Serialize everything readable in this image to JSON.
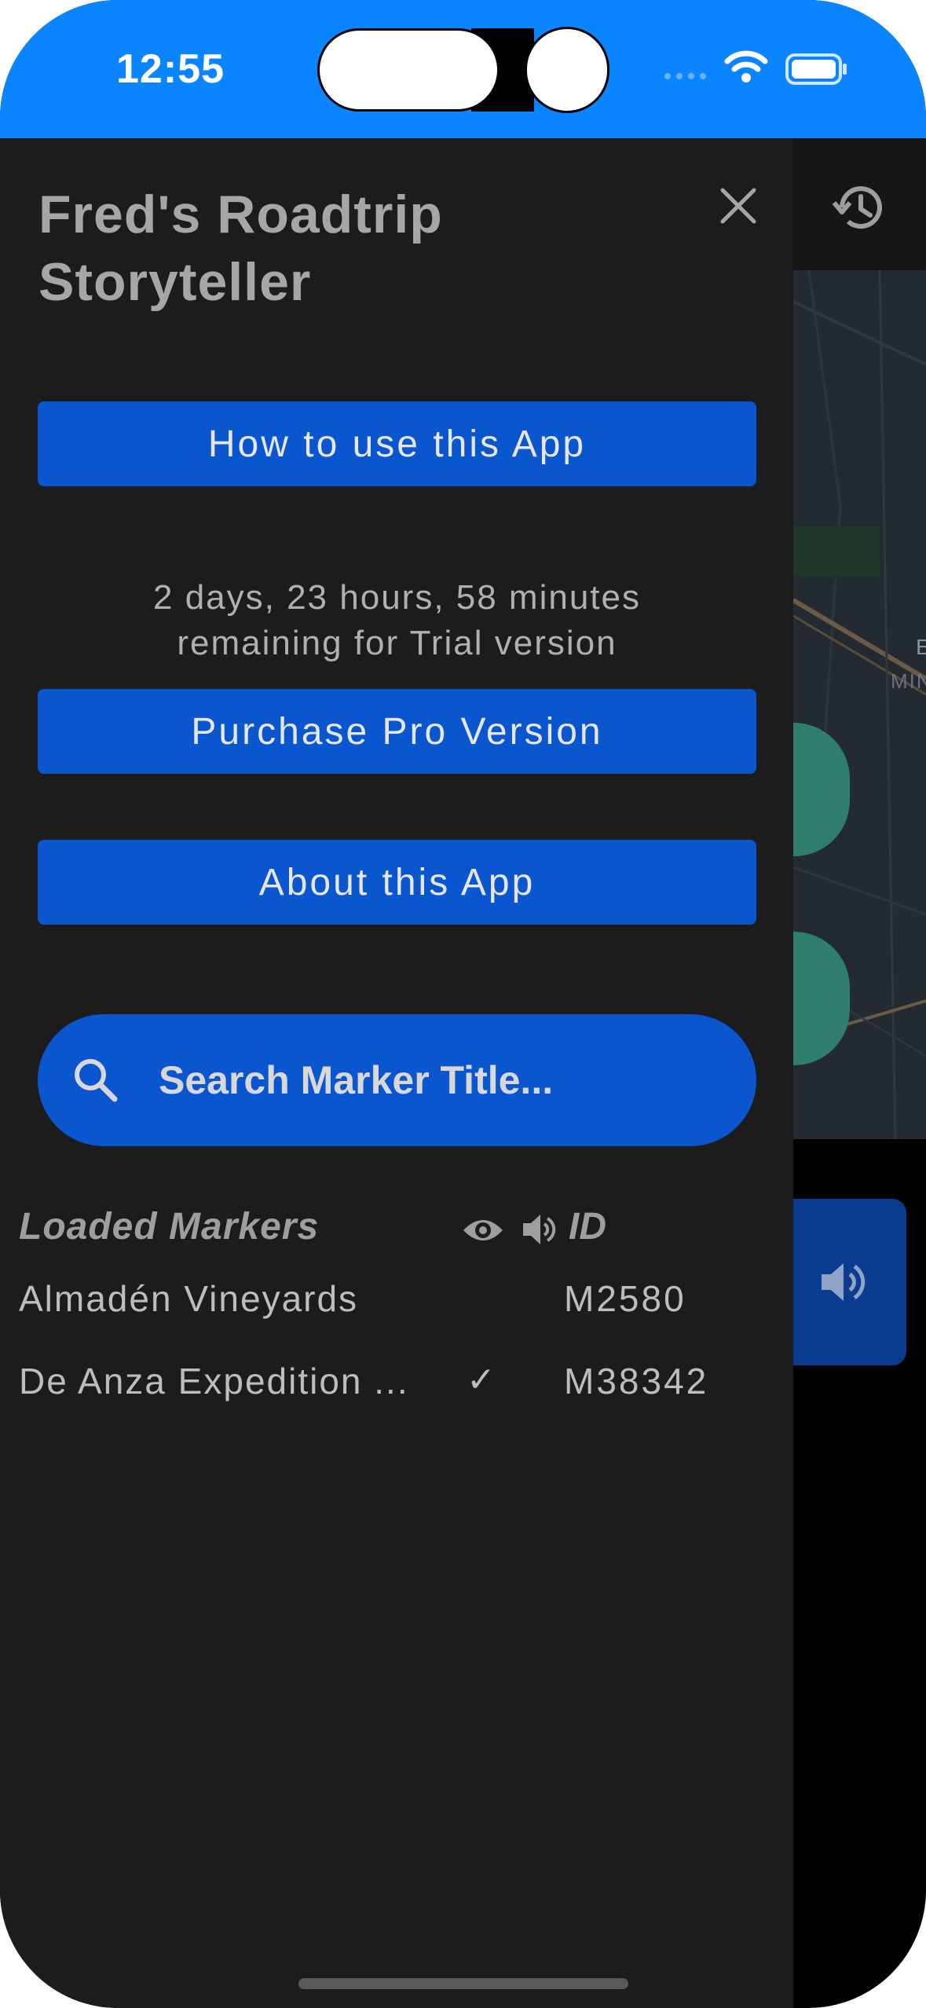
{
  "status_bar": {
    "time": "12:55",
    "background_color": "#0a84ff"
  },
  "drawer": {
    "title": "Fred's Roadtrip\nStoryteller",
    "close_icon": "close-icon",
    "buttons": {
      "how_to": "How to use this App",
      "purchase": "Purchase Pro Version",
      "about": "About this App"
    },
    "trial": {
      "line1": "2 days, 23 hours, 58 minutes",
      "line2": "remaining for Trial version"
    },
    "search": {
      "placeholder": "Search Marker Title...",
      "value": ""
    },
    "markers": {
      "header": {
        "title": "Loaded Markers",
        "visible_icon": "eye-icon",
        "audio_icon": "speaker-icon",
        "id_label": "ID"
      },
      "rows": [
        {
          "title": "Almadén Vineyards",
          "played": "",
          "id": "M2580"
        },
        {
          "title": "De Anza Expedition ...",
          "played": "✓",
          "id": "M38342"
        }
      ]
    }
  },
  "background_app": {
    "history_icon": "history-icon",
    "audio_icon": "speaker-icon",
    "accent_color": "#0a56cf",
    "map_marker_color": "#2e7d6e"
  }
}
